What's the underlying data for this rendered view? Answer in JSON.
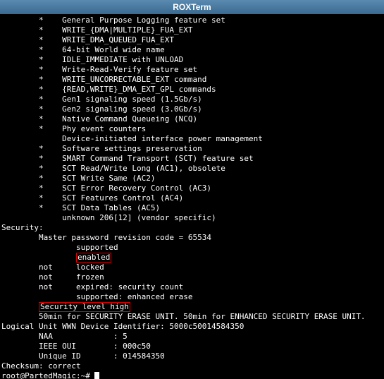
{
  "window": {
    "title": "ROXTerm"
  },
  "lines": {
    "l00": "        *    General Purpose Logging feature set",
    "l01": "        *    WRITE_{DMA|MULTIPLE}_FUA_EXT",
    "l02": "        *    WRITE_DMA_QUEUED_FUA_EXT",
    "l03": "        *    64-bit World wide name",
    "l04": "        *    IDLE_IMMEDIATE with UNLOAD",
    "l05": "        *    Write-Read-Verify feature set",
    "l06": "        *    WRITE_UNCORRECTABLE_EXT command",
    "l07": "        *    {READ,WRITE}_DMA_EXT_GPL commands",
    "l08": "        *    Gen1 signaling speed (1.5Gb/s)",
    "l09": "        *    Gen2 signaling speed (3.0Gb/s)",
    "l10": "        *    Native Command Queueing (NCQ)",
    "l11": "        *    Phy event counters",
    "l12": "             Device-initiated interface power management",
    "l13": "        *    Software settings preservation",
    "l14": "        *    SMART Command Transport (SCT) feature set",
    "l15": "        *    SCT Read/Write Long (AC1), obsolete",
    "l16": "        *    SCT Write Same (AC2)",
    "l17": "        *    SCT Error Recovery Control (AC3)",
    "l18": "        *    SCT Features Control (AC4)",
    "l19": "        *    SCT Data Tables (AC5)",
    "l20": "             unknown 206[12] (vendor specific)",
    "l21": "Security:",
    "l22": "        Master password revision code = 65534",
    "l23": "                supported",
    "l24_pre": "                ",
    "l24_box": "enabled",
    "l25": "        not     locked",
    "l26": "        not     frozen",
    "l27": "        not     expired: security count",
    "l28": "                supported: enhanced erase",
    "l29_pre": "        ",
    "l29_box": "Security level high",
    "l30": "        50min for SECURITY ERASE UNIT. 50min for ENHANCED SECURITY ERASE UNIT.",
    "l31": "Logical Unit WWN Device Identifier: 5000c50014584350",
    "l32": "        NAA             : 5",
    "l33": "        IEEE OUI        : 000c50",
    "l34": "        Unique ID       : 014584350",
    "l35": "Checksum: correct",
    "prompt": "root@PartedMagic:~# "
  }
}
